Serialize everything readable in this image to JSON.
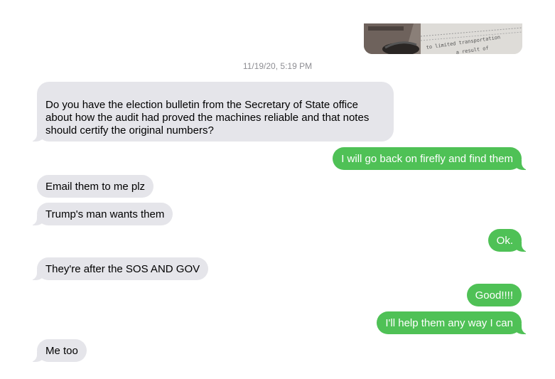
{
  "thread": {
    "timestamp": "11/19/20, 5:19 PM",
    "photo": {
      "visible_text_line1": "to limited transportation",
      "visible_text_line2": "a result of"
    },
    "messages": [
      {
        "direction": "incoming",
        "text": "Do you have the election bulletin from the Secretary of State office about how the audit had proved the machines reliable and that notes should certify the original numbers?"
      },
      {
        "direction": "outgoing",
        "text": "I will go back on firefly and find them"
      },
      {
        "direction": "incoming",
        "text": "Email them to me plz"
      },
      {
        "direction": "incoming",
        "text": "Trump's man wants them"
      },
      {
        "direction": "outgoing",
        "text": "Ok."
      },
      {
        "direction": "incoming",
        "text": "They're after the SOS  AND GOV"
      },
      {
        "direction": "outgoing",
        "text": "Good!!!!"
      },
      {
        "direction": "outgoing",
        "text": "I'll help them any way I can"
      },
      {
        "direction": "incoming",
        "text": "Me too"
      }
    ]
  },
  "colors": {
    "incoming_bubble": "#e5e5ea",
    "outgoing_bubble": "#4fc156",
    "timestamp_text": "#8e8e93"
  }
}
